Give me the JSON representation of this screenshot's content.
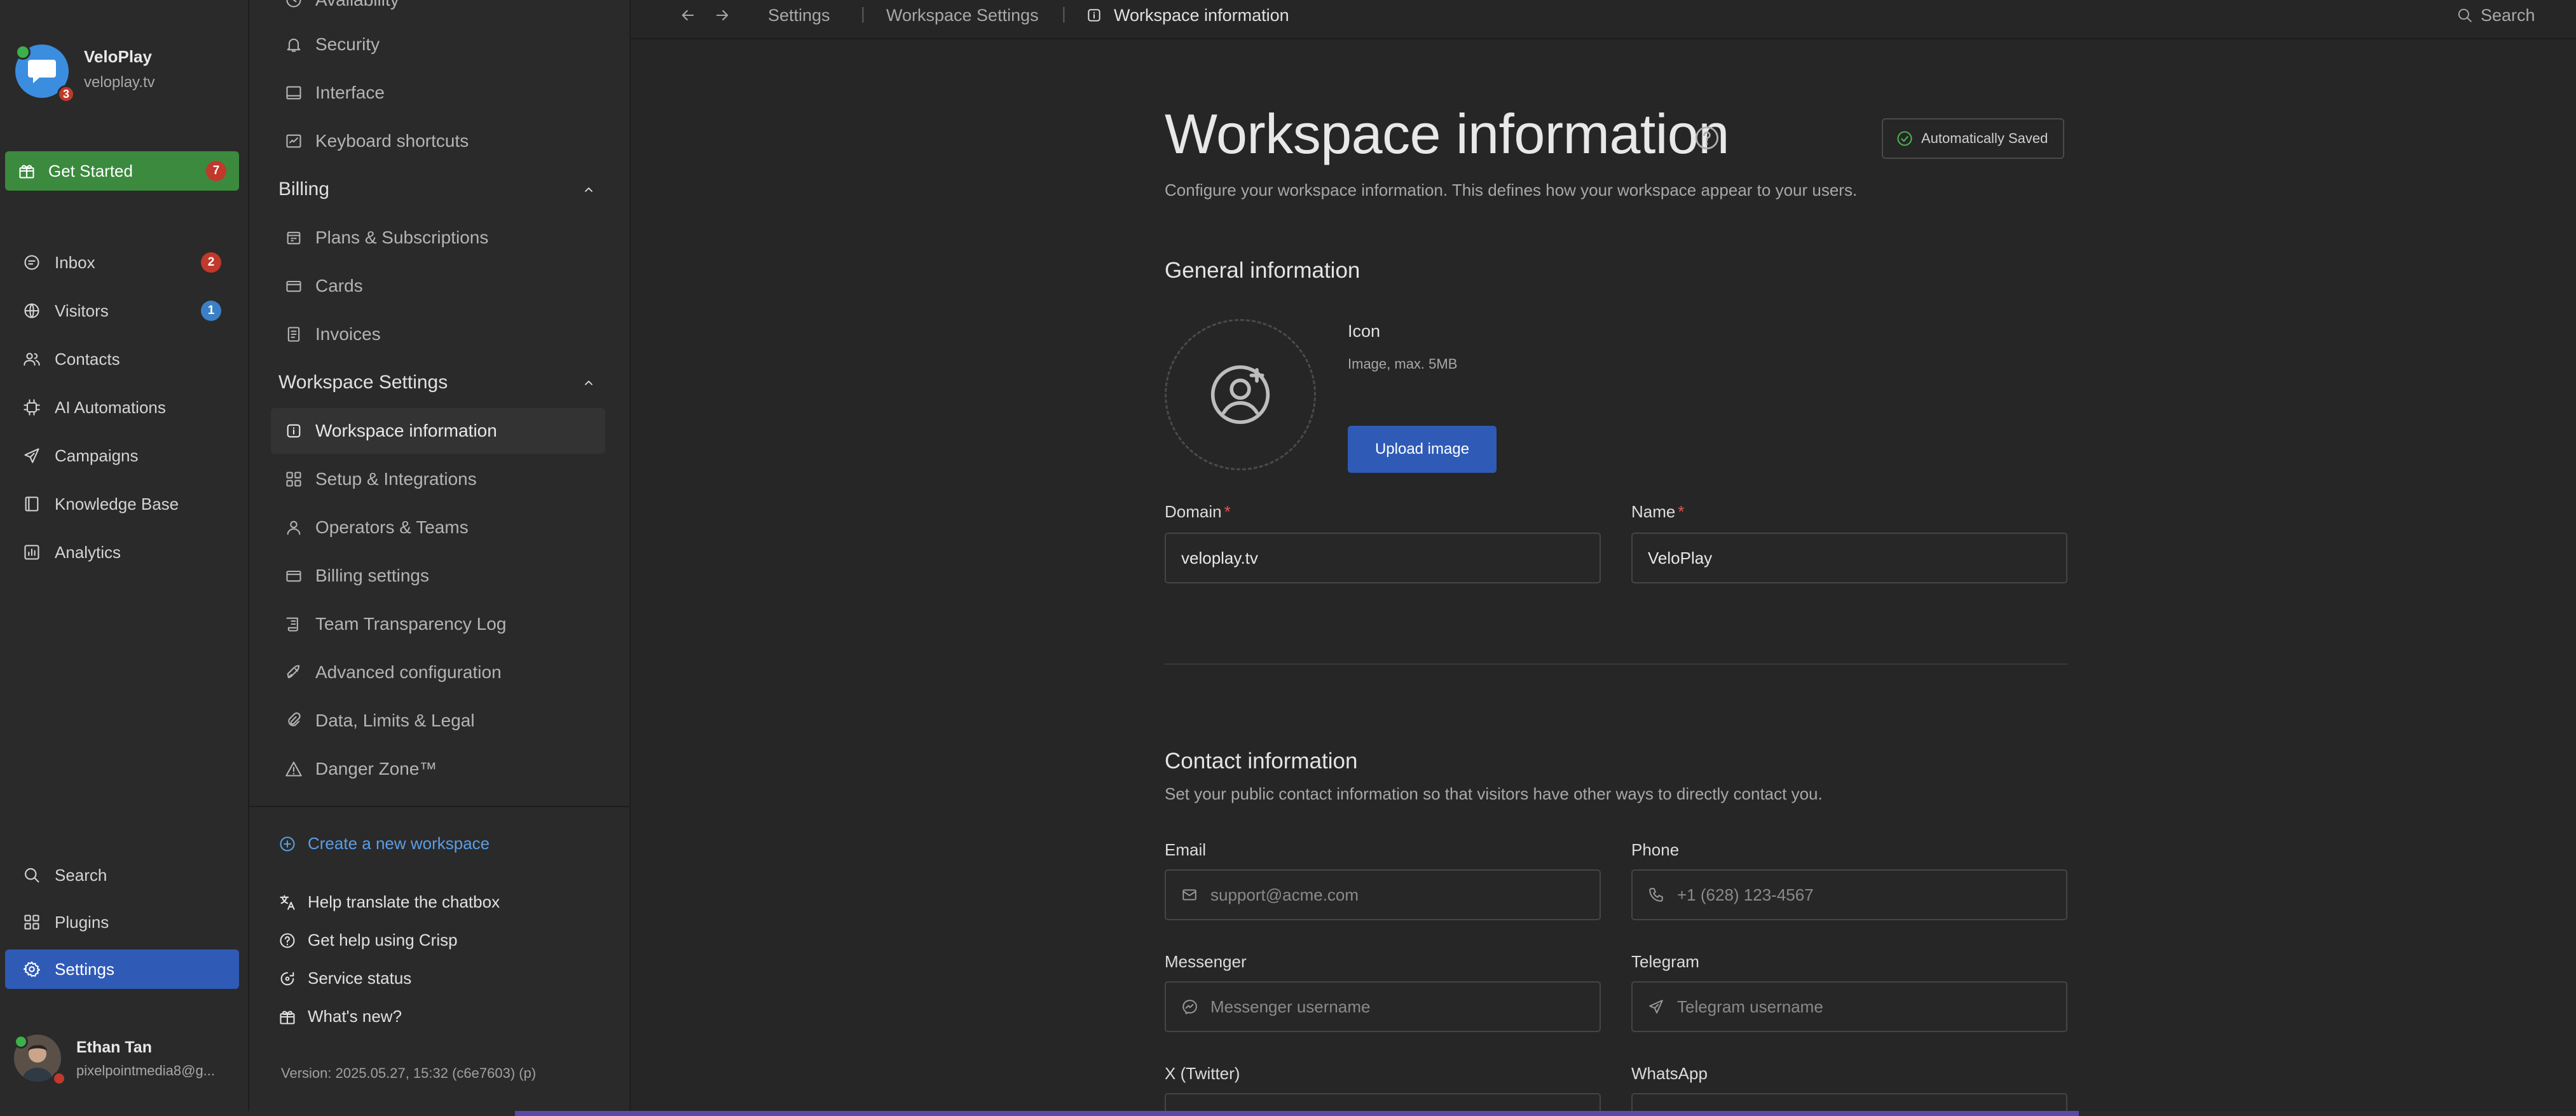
{
  "workspace": {
    "name": "VeloPlay",
    "domain": "veloplay.tv",
    "unread_count": "3"
  },
  "get_started": {
    "label": "Get Started",
    "count": "7"
  },
  "main_nav": [
    {
      "label": "Inbox",
      "icon": "inbox-icon",
      "badge": "2"
    },
    {
      "label": "Visitors",
      "icon": "globe-icon",
      "badge": "1"
    },
    {
      "label": "Contacts",
      "icon": "contacts-icon"
    },
    {
      "label": "AI Automations",
      "icon": "chip-icon"
    },
    {
      "label": "Campaigns",
      "icon": "send-icon"
    },
    {
      "label": "Knowledge Base",
      "icon": "book-icon"
    },
    {
      "label": "Analytics",
      "icon": "chart-icon"
    }
  ],
  "bottom_nav": [
    {
      "label": "Search",
      "icon": "search-icon"
    },
    {
      "label": "Plugins",
      "icon": "plugins-icon"
    },
    {
      "label": "Settings",
      "icon": "gear-icon"
    }
  ],
  "user": {
    "name": "Ethan Tan",
    "email": "pixelpointmedia8@g..."
  },
  "settings_nav": {
    "top_partial": "Availability",
    "account_items": [
      {
        "label": "Security",
        "icon": "bell-icon"
      },
      {
        "label": "Interface",
        "icon": "monitor-icon"
      },
      {
        "label": "Keyboard shortcuts",
        "icon": "keyboard-icon"
      }
    ],
    "billing": {
      "title": "Billing",
      "items": [
        {
          "label": "Plans & Subscriptions",
          "icon": "calendar-icon"
        },
        {
          "label": "Cards",
          "icon": "card-icon"
        },
        {
          "label": "Invoices",
          "icon": "document-icon"
        }
      ]
    },
    "workspace_settings": {
      "title": "Workspace Settings",
      "items": [
        {
          "label": "Workspace information",
          "icon": "info-icon"
        },
        {
          "label": "Setup & Integrations",
          "icon": "grid-icon"
        },
        {
          "label": "Operators & Teams",
          "icon": "user-icon"
        },
        {
          "label": "Billing settings",
          "icon": "card-icon"
        },
        {
          "label": "Team Transparency Log",
          "icon": "log-icon"
        },
        {
          "label": "Advanced configuration",
          "icon": "rocket-icon"
        },
        {
          "label": "Data, Limits & Legal",
          "icon": "paperclip-icon"
        },
        {
          "label": "Danger Zone™",
          "icon": "warning-icon"
        }
      ]
    },
    "create_workspace": "Create a new workspace",
    "help_links": [
      {
        "label": "Help translate the chatbox",
        "icon": "translate-icon"
      },
      {
        "label": "Get help using Crisp",
        "icon": "help-circle-icon"
      },
      {
        "label": "Service status",
        "icon": "status-icon"
      },
      {
        "label": "What's new?",
        "icon": "gift-icon"
      }
    ],
    "version": "Version: 2025.05.27, 15:32 (c6e7603) (p)"
  },
  "breadcrumb": {
    "items": [
      "Settings",
      "Workspace Settings",
      "Workspace information"
    ],
    "separator": "|",
    "search": "Search"
  },
  "page": {
    "title": "Workspace information",
    "subtitle": "Configure your workspace information. This defines how your workspace appear to your users.",
    "autosave": "Automatically Saved"
  },
  "general": {
    "title": "General information",
    "icon_label": "Icon",
    "icon_hint": "Image, max. 5MB",
    "upload_label": "Upload image",
    "domain_label": "Domain",
    "domain_value": "veloplay.tv",
    "name_label": "Name",
    "name_value": "VeloPlay",
    "required_mark": "*"
  },
  "contact": {
    "title": "Contact information",
    "subtitle": "Set your public contact information so that visitors have other ways to directly contact you.",
    "email_label": "Email",
    "email_placeholder": "support@acme.com",
    "phone_label": "Phone",
    "phone_placeholder": "+1 (628) 123-4567",
    "messenger_label": "Messenger",
    "messenger_placeholder": "Messenger username",
    "telegram_label": "Telegram",
    "telegram_placeholder": "Telegram username",
    "twitter_label": "X (Twitter)",
    "whatsapp_label": "WhatsApp"
  },
  "colors": {
    "accent": "#2f5bb7",
    "success": "#3b8a3e",
    "badge_red": "#c0392b",
    "badge_blue": "#3b80c6",
    "link": "#5a9ee6"
  }
}
